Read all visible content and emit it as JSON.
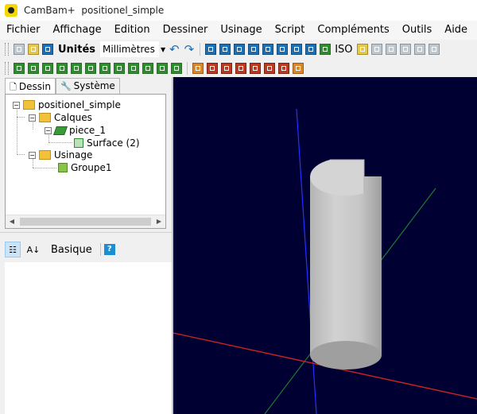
{
  "titlebar": {
    "app_name": "CamBam+",
    "document": "positionel_simple"
  },
  "menu": [
    "Fichier",
    "Affichage",
    "Edition",
    "Dessiner",
    "Usinage",
    "Script",
    "Compléments",
    "Outils",
    "Aide"
  ],
  "toolbar": {
    "units_label": "Unités",
    "units_value": "Millimètres",
    "iso_label": "ISO",
    "icons_row1": [
      "new-file-icon",
      "open-folder-icon",
      "save-icon"
    ],
    "icons_view": [
      "grid-icon",
      "snap-grid-icon",
      "view-left-icon",
      "view-front-icon",
      "view-top-icon",
      "view-right-icon",
      "view-back-icon",
      "view-bottom-icon",
      "rotate-view-icon"
    ],
    "icons_cube": [
      "cube-shaded-icon",
      "cube-front-icon",
      "cube-left-icon",
      "cube-right-icon",
      "cube-top-icon",
      "cube-back-icon"
    ],
    "icons_draw": [
      "point-icon",
      "circle-icon",
      "rectangle-icon",
      "polyline-icon",
      "text-icon",
      "arc-icon",
      "spline-icon",
      "region-icon",
      "surface-icon",
      "hatch-icon",
      "extrude-icon",
      "edit-icon"
    ],
    "icons_machining": [
      "profile-op-icon",
      "pocket-op-icon",
      "drill-op-icon",
      "engrave-op-icon",
      "3d-op-icon",
      "lathe-op-icon",
      "gcode-icon",
      "post-icon"
    ]
  },
  "tabs": {
    "drawing": "Dessin",
    "system": "Système"
  },
  "tree": {
    "root": "positionel_simple",
    "layers": "Calques",
    "layer_name": "piece_1",
    "surface": "Surface (2)",
    "machining": "Usinage",
    "group": "Groupe1"
  },
  "properties": {
    "mode": "Basique",
    "help": "?"
  },
  "colors": {
    "viewport_bg": "#000033",
    "x_axis": "#cc2222",
    "y_axis": "#1f7a2e",
    "z_axis": "#2233ff",
    "part": "#c8c8c8"
  }
}
